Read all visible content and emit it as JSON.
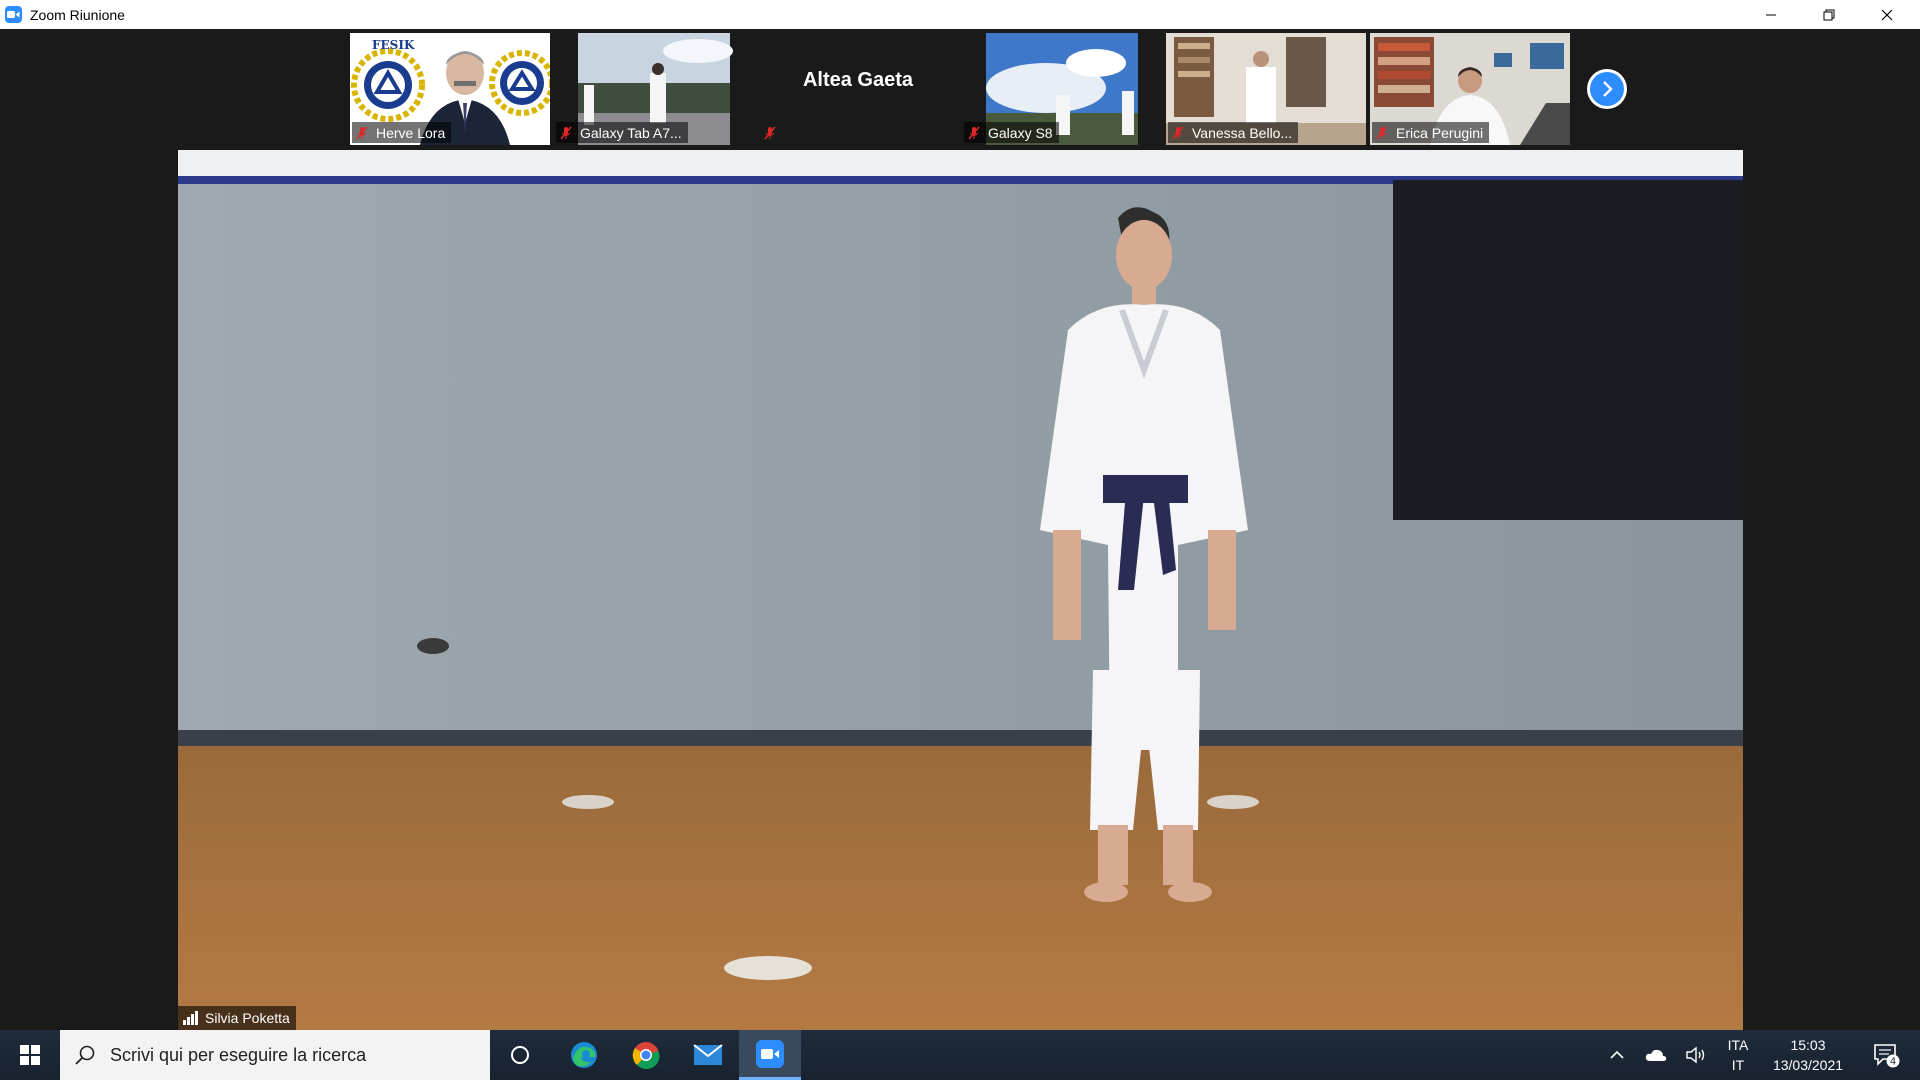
{
  "window": {
    "title": "Zoom Riunione"
  },
  "participants": [
    {
      "name": "Herve Lora",
      "muted": true
    },
    {
      "name": "Galaxy Tab A7...",
      "muted": true
    },
    {
      "name": "Altea Gaeta",
      "muted": true,
      "video_off": true
    },
    {
      "name": "Galaxy S8",
      "muted": true
    },
    {
      "name": "Vanessa Bello...",
      "muted": true
    },
    {
      "name": "Erica Perugini",
      "muted": true
    }
  ],
  "active_speaker": {
    "name": "Silvia Poketta"
  },
  "thumbnail_logo_text": "FESIK",
  "taskbar": {
    "search_placeholder": "Scrivi qui per eseguire la ricerca",
    "language_line1": "ITA",
    "language_line2": "IT",
    "time": "15:03",
    "date": "13/03/2021",
    "notification_count": "4"
  },
  "colors": {
    "zoom_blue": "#2d8cff",
    "mute_red": "#e02828",
    "background": "#1a1a1a"
  }
}
